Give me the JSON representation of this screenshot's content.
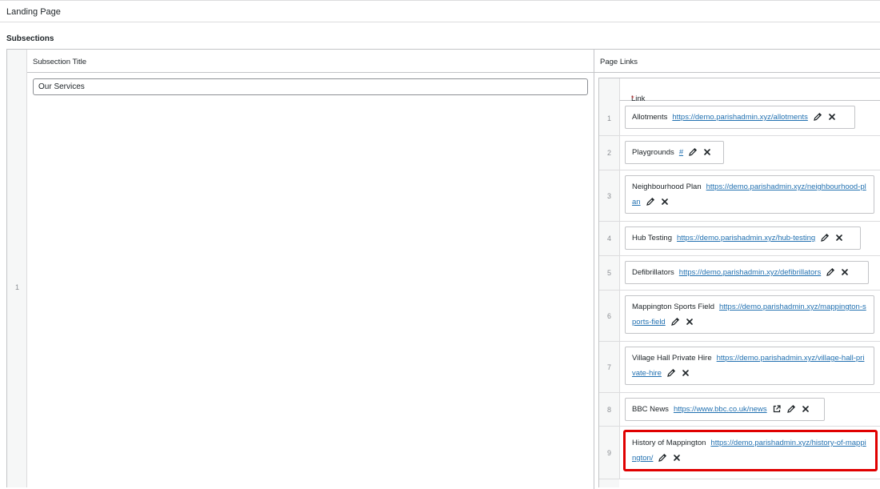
{
  "page": {
    "title": "Landing Page"
  },
  "subsections": {
    "label": "Subsections",
    "header_title": "Subsection Title",
    "header_links": "Page Links",
    "row_number": "1",
    "title_value": "Our Services"
  },
  "links_table": {
    "header": "Link",
    "required_mark": "*",
    "rows": [
      {
        "num": "1",
        "title": "Allotments",
        "url": "https://demo.parishadmin.xyz/allotments"
      },
      {
        "num": "2",
        "title": "Playgrounds",
        "url": "#"
      },
      {
        "num": "3",
        "title": "Neighbourhood Plan",
        "url": "https://demo.parishadmin.xyz/neighbourhood-plan"
      },
      {
        "num": "4",
        "title": "Hub Testing",
        "url": "https://demo.parishadmin.xyz/hub-testing"
      },
      {
        "num": "5",
        "title": "Defibrillators",
        "url": "https://demo.parishadmin.xyz/defibrillators"
      },
      {
        "num": "6",
        "title": "Mappington Sports Field",
        "url": "https://demo.parishadmin.xyz/mappington-sports-field"
      },
      {
        "num": "7",
        "title": "Village Hall Private Hire",
        "url": "https://demo.parishadmin.xyz/village-hall-private-hire"
      },
      {
        "num": "8",
        "title": "BBC News",
        "url": "https://www.bbc.co.uk/news",
        "external": true
      },
      {
        "num": "9",
        "title": "History of Mappington",
        "url": "https://demo.parishadmin.xyz/history-of-mappington/",
        "highlighted": true
      }
    ]
  },
  "colors": {
    "link": "#2271b1",
    "highlight": "#e00000",
    "border": "#c3c4c7",
    "required": "#d63638"
  }
}
